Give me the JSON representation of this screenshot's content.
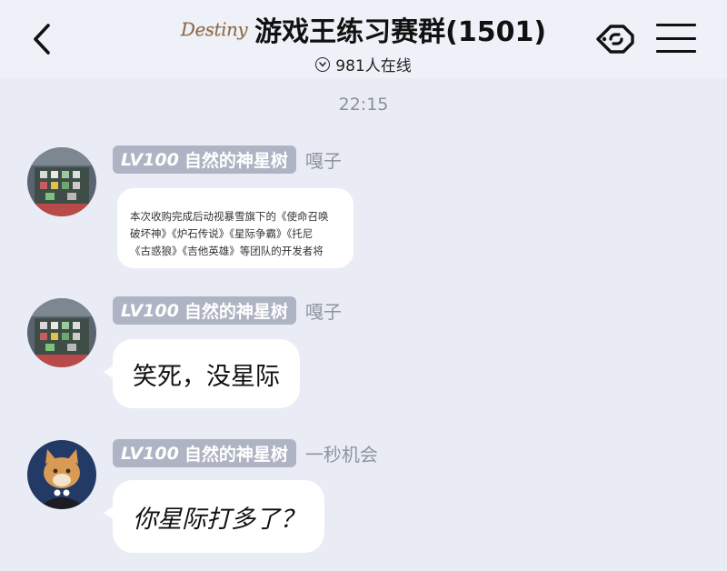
{
  "header": {
    "back_icon": "back-arrow-icon",
    "logo_text": "Destiny",
    "title": "游戏王练习赛群(1501)",
    "online_count": "981人在线",
    "link_icon": "link-tag-icon",
    "menu_icon": "hamburger-menu-icon"
  },
  "chat": {
    "timestamp": "22:15",
    "messages": [
      {
        "level": "LV100",
        "level_title": "自然的神星树",
        "sender": "嘎子",
        "type": "quote-card",
        "lines": [
          "本次收购完成后动视暴雪旗下的《使命召唤",
          "破坏神》《炉石传说》《星际争霸》《托尼",
          "《古惑狼》《吉他英雄》等团队的开发者将"
        ]
      },
      {
        "level": "LV100",
        "level_title": "自然的神星树",
        "sender": "嘎子",
        "type": "text",
        "text": "笑死，没星际"
      },
      {
        "level": "LV100",
        "level_title": "自然的神星树",
        "sender": "一秒机会",
        "type": "text",
        "text": "你星际打多了？"
      }
    ]
  },
  "colors": {
    "background": "#e9ecf5",
    "badge": "#aeb4c3",
    "bubble": "#ffffff"
  }
}
